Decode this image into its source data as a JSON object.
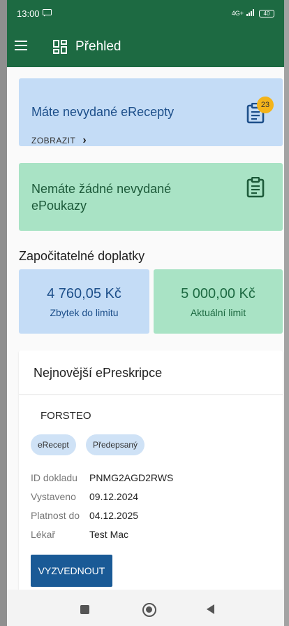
{
  "status_bar": {
    "time": "13:00",
    "network": "4G+",
    "battery": "40"
  },
  "toolbar": {
    "title": "Přehled"
  },
  "erecept_card": {
    "title": "Máte nevydané eRecepty",
    "link_label": "ZOBRAZIT",
    "badge_count": "23"
  },
  "epoukaz_card": {
    "title": "Nemáte žádné nevydané ePoukazy"
  },
  "copayments": {
    "section_title": "Započitatelné doplatky",
    "remaining": {
      "value": "4 760,05  Kč",
      "label": "Zbytek do limitu"
    },
    "limit": {
      "value": "5 000,00  Kč",
      "label": "Aktuální limit"
    }
  },
  "latest": {
    "title": "Nejnovější ePreskripce",
    "drug_name": "FORSTEO",
    "chips": [
      "eRecept",
      "Předepsaný"
    ],
    "rows": [
      {
        "label": "ID dokladu",
        "value": "PNMG2AGD2RWS"
      },
      {
        "label": "Vystaveno",
        "value": "09.12.2024"
      },
      {
        "label": "Platnost do",
        "value": "04.12.2025"
      },
      {
        "label": "Lékař",
        "value": "Test Mac"
      }
    ],
    "action_label": "VYZVEDNOUT"
  },
  "colors": {
    "app_bar": "#1d6a42",
    "blue_card": "#c4dcf6",
    "green_card": "#a9e3c5",
    "primary_button": "#1a5a96",
    "badge": "#f4b41a"
  },
  "icons": [
    "message-icon",
    "signal-icon",
    "battery-icon",
    "menu-icon",
    "dashboard-icon",
    "clipboard-icon",
    "chevron-right-icon",
    "square-icon",
    "circle-icon",
    "back-triangle-icon"
  ]
}
